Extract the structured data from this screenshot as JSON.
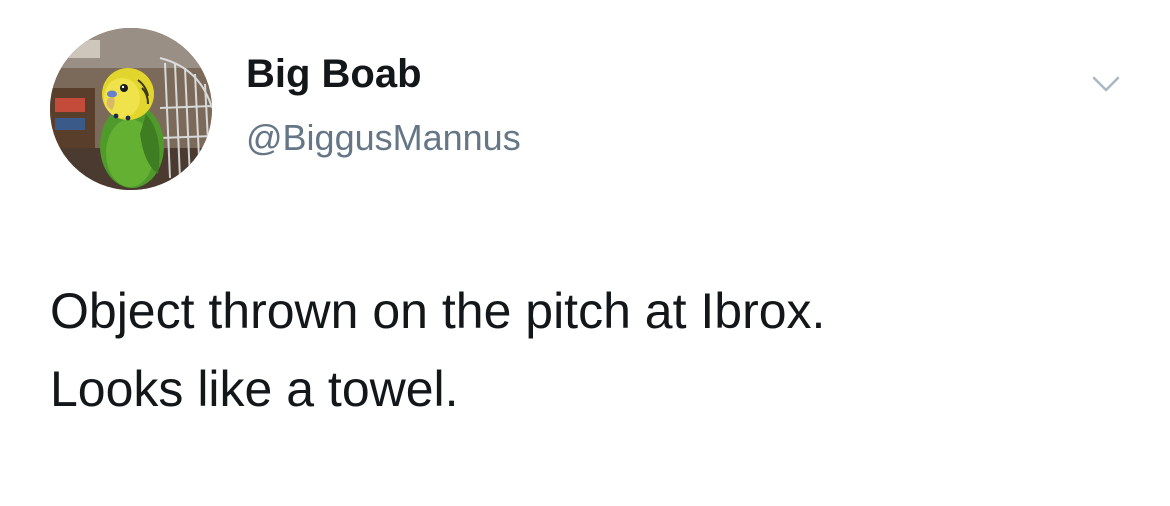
{
  "tweet": {
    "author": {
      "display_name": "Big Boab",
      "handle": "@BiggusMannus",
      "avatar_icon": "budgie-avatar"
    },
    "menu_icon": "chevron-down-icon",
    "text_lines": [
      "Object thrown on the pitch at Ibrox.",
      "Looks like a towel."
    ]
  },
  "colors": {
    "background": "#ffffff",
    "name_text": "#14171a",
    "handle_text": "#657786",
    "chevron": "#aab8c2"
  }
}
